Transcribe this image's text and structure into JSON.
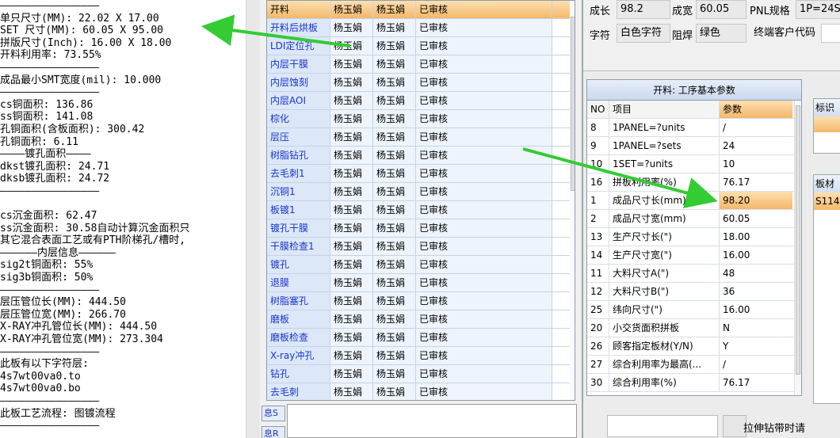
{
  "left_text": {
    "lines": [
      "————————————————",
      "单只尺寸(MM): 22.02 X 17.00",
      "SET 尺寸(MM): 60.05 X 95.00",
      "拼版尺寸(Inch): 16.00 X 18.00",
      "开料利用率: 73.55%",
      "————————————————",
      "成品最小SMT宽度(mil): 10.000",
      "————————————————",
      "cs铜面积: 136.86",
      "ss铜面积: 141.08",
      "孔铜面积(含板面积): 300.42",
      "孔铜面积: 6.11",
      "————镀孔面积————",
      "dkst镀孔面积: 24.71",
      "dksb镀孔面积: 24.72",
      "————————————————",
      "",
      "cs沉金面积: 62.47",
      "ss沉金面积: 30.58自动计算沉金面积只",
      "其它混合表面工艺或有PTH阶梯孔/槽时,",
      "——————内层信息——————",
      "sig2t铜面积: 55%",
      "sig3b铜面积: 50%",
      "————————————————",
      "层压管位长(MM): 444.50",
      "层压管位宽(MM): 266.70",
      "X-RAY冲孔管位长(MM): 444.50",
      "X-RAY冲孔管位宽(MM): 273.304",
      "————————————————",
      "此板有以下字符层:",
      "4s7wt00va0.to",
      "4s7wt00va0.bo",
      "————————————————",
      "此板工艺流程: 图镀流程",
      "————————————————"
    ]
  },
  "process_grid": {
    "rows": [
      {
        "step": "开料",
        "a": "杨玉娟",
        "b": "杨玉娟",
        "status": "已审核",
        "selected": true
      },
      {
        "step": "开料后烘板",
        "a": "杨玉娟",
        "b": "杨玉娟",
        "status": "已审核"
      },
      {
        "step": "LDI定位孔",
        "a": "杨玉娟",
        "b": "杨玉娟",
        "status": "已审核"
      },
      {
        "step": "内层干膜",
        "a": "杨玉娟",
        "b": "杨玉娟",
        "status": "已审核"
      },
      {
        "step": "内层蚀刻",
        "a": "杨玉娟",
        "b": "杨玉娟",
        "status": "已审核"
      },
      {
        "step": "内层AOI",
        "a": "杨玉娟",
        "b": "杨玉娟",
        "status": "已审核"
      },
      {
        "step": "棕化",
        "a": "杨玉娟",
        "b": "杨玉娟",
        "status": "已审核"
      },
      {
        "step": "层压",
        "a": "杨玉娟",
        "b": "杨玉娟",
        "status": "已审核"
      },
      {
        "step": "树脂钻孔",
        "a": "杨玉娟",
        "b": "杨玉娟",
        "status": "已审核"
      },
      {
        "step": "去毛刺1",
        "a": "杨玉娟",
        "b": "杨玉娟",
        "status": "已审核"
      },
      {
        "step": "沉铜1",
        "a": "杨玉娟",
        "b": "杨玉娟",
        "status": "已审核"
      },
      {
        "step": "板镀1",
        "a": "杨玉娟",
        "b": "杨玉娟",
        "status": "已审核"
      },
      {
        "step": "镀孔干膜",
        "a": "杨玉娟",
        "b": "杨玉娟",
        "status": "已审核"
      },
      {
        "step": "干膜检查1",
        "a": "杨玉娟",
        "b": "杨玉娟",
        "status": "已审核"
      },
      {
        "step": "镀孔",
        "a": "杨玉娟",
        "b": "杨玉娟",
        "status": "已审核"
      },
      {
        "step": "退膜",
        "a": "杨玉娟",
        "b": "杨玉娟",
        "status": "已审核"
      },
      {
        "step": "树脂塞孔",
        "a": "杨玉娟",
        "b": "杨玉娟",
        "status": "已审核"
      },
      {
        "step": "磨板",
        "a": "杨玉娟",
        "b": "杨玉娟",
        "status": "已审核"
      },
      {
        "step": "磨板检查",
        "a": "杨玉娟",
        "b": "杨玉娟",
        "status": "已审核"
      },
      {
        "step": "X-ray冲孔",
        "a": "杨玉娟",
        "b": "杨玉娟",
        "status": "已审核"
      },
      {
        "step": "钻孔",
        "a": "杨玉娟",
        "b": "杨玉娟",
        "status": "已审核"
      },
      {
        "step": "去毛刺",
        "a": "杨玉娟",
        "b": "杨玉娟",
        "status": "已审核"
      }
    ],
    "side_tabs": [
      "息S",
      "息R"
    ]
  },
  "top_fields": {
    "chengchang_label": "成长",
    "chengchang_value": "98.2",
    "chengkuan_label": "成宽",
    "chengkuan_value": "60.05",
    "pnl_label": "PNL规格",
    "pnl_value": "1P=24S",
    "zifu_label": "字符",
    "zifu_value": "白色字符",
    "zuhan_label": "阻焊",
    "zuhan_value": "绿色",
    "customer_code_label": "终端客户代码"
  },
  "param_panel": {
    "title": "开料: 工序基本参数",
    "col_no": "NO",
    "col_item": "项目",
    "col_value": "参数",
    "rows": [
      {
        "no": "8",
        "item": "1PANEL=?units",
        "value": "/"
      },
      {
        "no": "9",
        "item": "1PANEL=?sets",
        "value": "24"
      },
      {
        "no": "10",
        "item": "1SET=?units",
        "value": "10"
      },
      {
        "no": "16",
        "item": "拼板利用率(%)",
        "value": "76.17"
      },
      {
        "no": "1",
        "item": "成品尺寸长(mm)",
        "value": "98.20",
        "highlight": true
      },
      {
        "no": "2",
        "item": "成品尺寸宽(mm)",
        "value": "60.05"
      },
      {
        "no": "13",
        "item": "生产尺寸长(\")",
        "value": "18.00"
      },
      {
        "no": "14",
        "item": "生产尺寸宽(\")",
        "value": "16.00"
      },
      {
        "no": "11",
        "item": "大料尺寸A(\")",
        "value": "48"
      },
      {
        "no": "12",
        "item": "大料尺寸B(\")",
        "value": "36"
      },
      {
        "no": "25",
        "item": "纬向尺寸(\")",
        "value": "16.00"
      },
      {
        "no": "20",
        "item": "小交货面积拼板",
        "value": "N"
      },
      {
        "no": "26",
        "item": "顾客指定板材(Y/N)",
        "value": "Y"
      },
      {
        "no": "27",
        "item": "综合利用率为最高(...",
        "value": "/"
      },
      {
        "no": "30",
        "item": "综合利用率(%)",
        "value": "76.17"
      }
    ]
  },
  "right_side": {
    "box1_header": "标识",
    "box2_header": "板材",
    "box2_value": "S114"
  },
  "bottom_bar": {
    "label": "拉伸钻带时请"
  },
  "colors": {
    "arrow": "#33cc33",
    "selected_row": "#f4b76a",
    "link_text": "#1a33cc"
  }
}
